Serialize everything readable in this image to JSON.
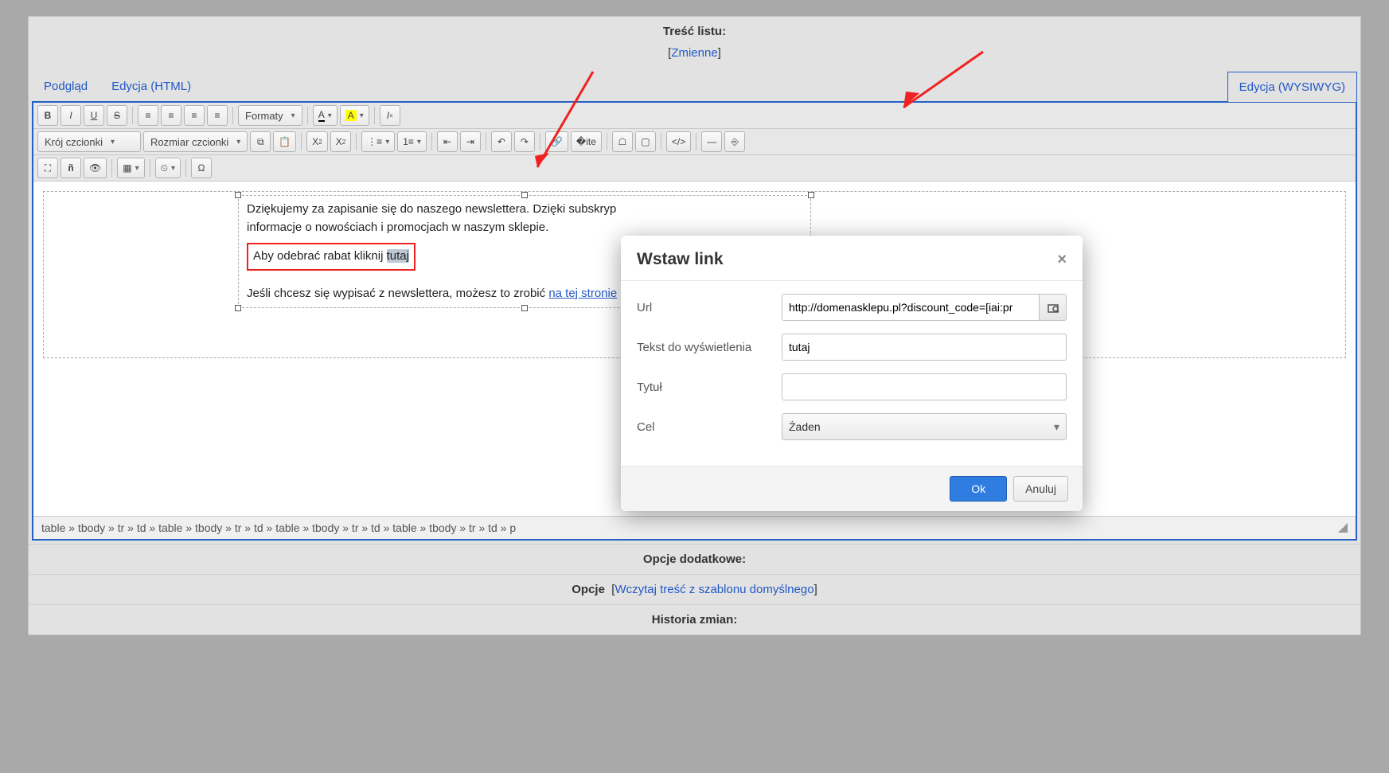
{
  "header": {
    "title": "Treść listu:",
    "variablesLabel": "Zmienne"
  },
  "tabs": {
    "preview": "Podgląd",
    "htmlEdit": "Edycja (HTML)",
    "wysiwyg": "Edycja (WYSIWYG)"
  },
  "toolbar": {
    "formats": "Formaty",
    "fontFamily": "Krój czcionki",
    "fontSize": "Rozmiar czcionki",
    "textA": "A",
    "bgA": "A"
  },
  "content": {
    "para1": "Dziękujemy za zapisanie się do naszego newslettera. Dzięki subskryp",
    "para1b": "informacje o nowościach i promocjach w naszym sklepie.",
    "redPrefix": "Aby odebrać rabat kliknij ",
    "redWord": "tutaj",
    "unsubPre": "Jeśli chcesz się wypisać z newslettera, możesz to zrobić ",
    "unsubLink": "na tej stronie"
  },
  "statusPath": "table » tbody » tr » td » table » tbody » tr » td » table » tbody » tr » td » table » tbody » tr » td » p",
  "options": {
    "extraTitle": "Opcje dodatkowe:",
    "opLabel": "Opcje",
    "opLink": "Wczytaj treść z szablonu domyślnego",
    "histTitle": "Historia zmian:"
  },
  "modal": {
    "title": "Wstaw link",
    "urlLab": "Url",
    "urlVal": "http://domenasklepu.pl?discount_code=[iai:pr",
    "textLab": "Tekst do wyświetlenia",
    "textVal": "tutaj",
    "titleLab": "Tytuł",
    "titleVal": "",
    "targetLab": "Cel",
    "targetVal": "Żaden",
    "ok": "Ok",
    "cancel": "Anuluj"
  }
}
